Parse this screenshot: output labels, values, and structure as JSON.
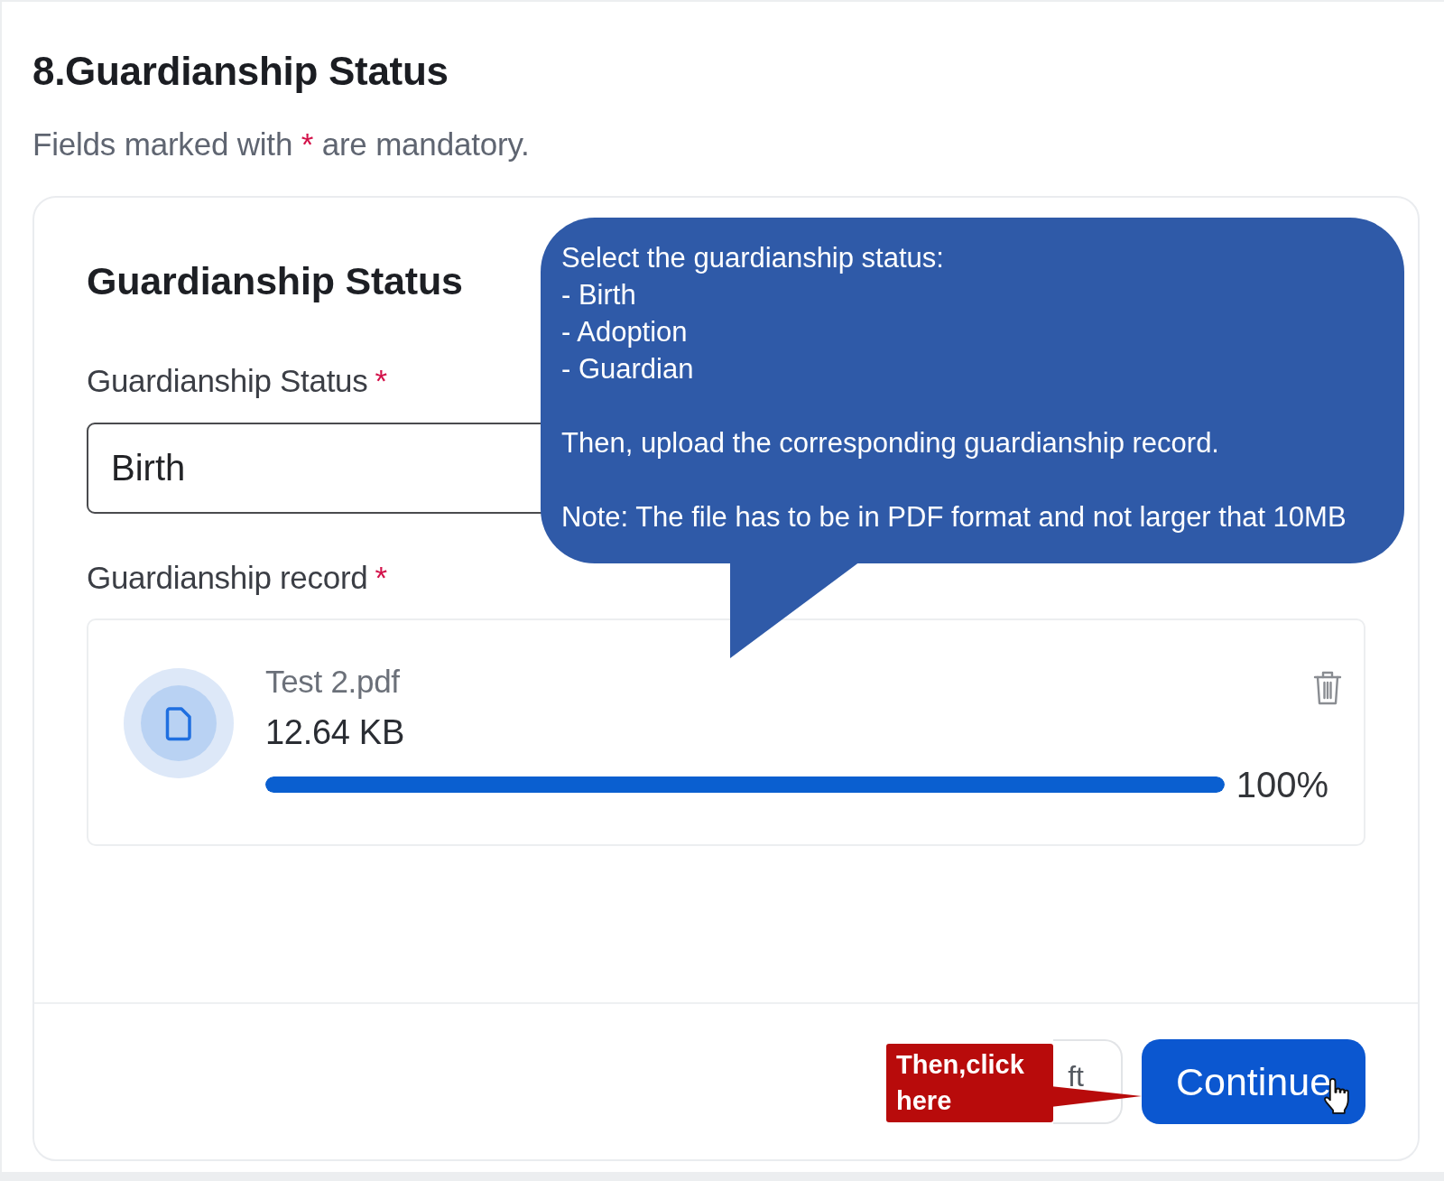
{
  "heading": "8.Guardianship Status",
  "mandatory_note": {
    "before": "Fields marked with",
    "required_mark": "*",
    "after": "are mandatory."
  },
  "card": {
    "title": "Guardianship Status",
    "status_field": {
      "label": "Guardianship Status",
      "required_mark": "*",
      "value": "Birth"
    },
    "record_upload": {
      "label": "Guardianship record",
      "required_mark": "*",
      "file": {
        "name": "Test 2.pdf",
        "size": "12.64 KB",
        "level": 1,
        "percent": "100%"
      }
    },
    "buttons": [
      {
        "kind": "secondary",
        "label": "ft"
      },
      {
        "kind": "primary",
        "label": "Continue"
      }
    ]
  },
  "tooltip": {
    "heading": "Select the guardianship status:",
    "options": [
      "- Birth",
      "- Adoption",
      "- Guardian"
    ],
    "instruction": "Then, upload the corresponding guardianship record.",
    "note": "Note: The file has to be in PDF format and not larger that 10MB"
  },
  "hint": {
    "text": "Then,click here"
  }
}
